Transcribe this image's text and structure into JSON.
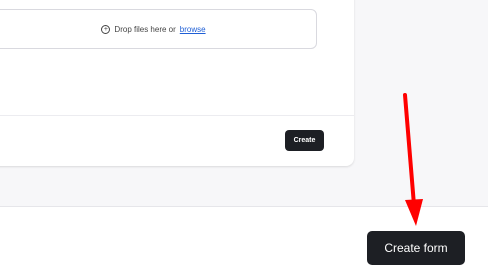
{
  "dropzone": {
    "icon": "plus-circle-icon",
    "text": "Drop files here or",
    "link_label": "browse"
  },
  "panel": {
    "create_label": "Create"
  },
  "footer": {
    "create_form_label": "Create form"
  },
  "annotation": {
    "arrow_color": "#ff0000"
  }
}
